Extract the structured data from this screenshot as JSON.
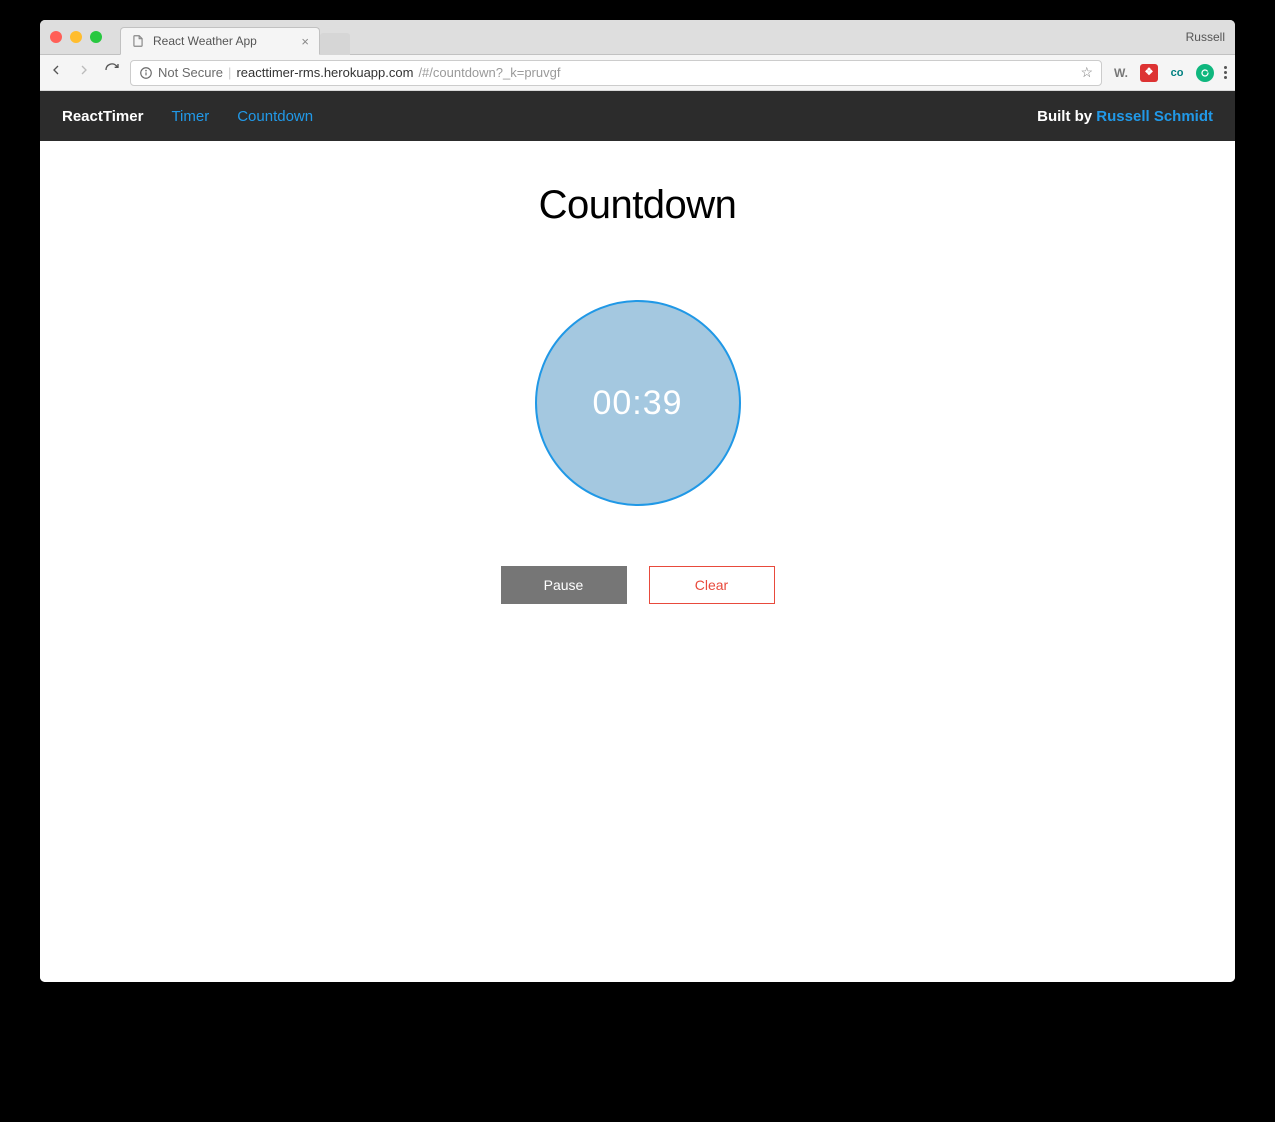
{
  "chrome": {
    "tab_title": "React Weather App",
    "profile_name": "Russell",
    "insecure_label": "Not Secure",
    "url_host": "reacttimer-rms.herokuapp.com",
    "url_path": "/#/countdown?_k=pruvgf"
  },
  "nav": {
    "brand": "ReactTimer",
    "links": [
      "Timer",
      "Countdown"
    ],
    "built_by_prefix": "Built by ",
    "author": "Russell Schmidt"
  },
  "page": {
    "heading": "Countdown",
    "time": "00:39",
    "pause_label": "Pause",
    "clear_label": "Clear"
  }
}
